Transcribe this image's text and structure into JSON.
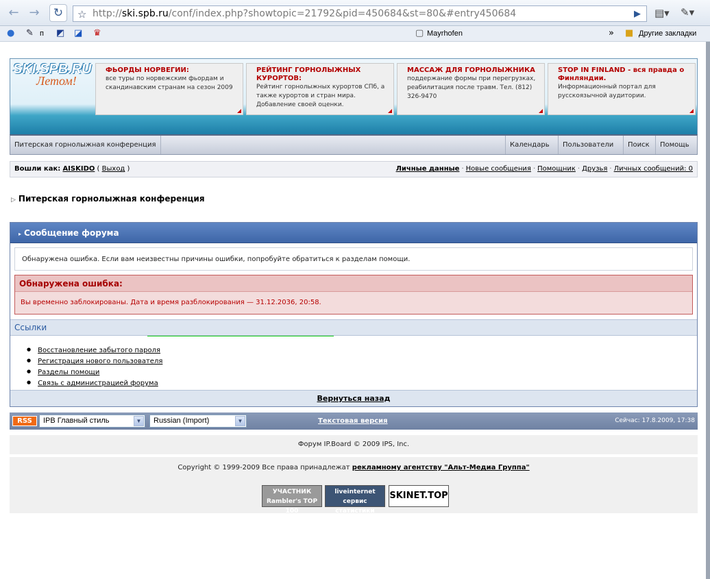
{
  "browser": {
    "url_prefix": "http://",
    "url_host": "ski.spb.ru",
    "url_rest": "/conf/index.php?showtopic=21792&pid=450684&st=80&#entry450684",
    "bookmarks": [
      "п",
      "Mayrhofen",
      "Другие закладки"
    ]
  },
  "banner": {
    "logo_top": "SKI.SPB.RU",
    "logo_bottom": "Летом!",
    "ads": [
      {
        "title": "ФЬОРДЫ НОРВЕГИИ:",
        "text": "все туры по норвежским фьордам и скандинавским странам на сезон 2009"
      },
      {
        "title": "РЕЙТИНГ ГОРНОЛЫЖНЫХ КУРОРТОВ:",
        "text": "Рейтинг горнолыжных курортов СПб, а также курортов и стран мира. Добавление своей оценки."
      },
      {
        "title": "МАССАЖ ДЛЯ ГОРНОЛЫЖНИКА",
        "text": "поддержание формы при перегрузках, реабилитация после травм. Тел. (812) 326-9470"
      },
      {
        "title": "STOP IN FINLAND - вся правда о Финляндии.",
        "text": "Информационный портал для русскоязычной аудитории."
      }
    ]
  },
  "menu": {
    "home": "Питерская горнолыжная конференция",
    "calendar": "Календарь",
    "users": "Пользователи",
    "search": "Поиск",
    "help": "Помощь"
  },
  "userbar": {
    "logged_as": "Вошли как:",
    "username": "AISKIDO",
    "logout": "Выход",
    "links": [
      "Личные данные",
      "Новые сообщения",
      "Помощник",
      "Друзья",
      "Личных сообщений: 0"
    ]
  },
  "breadcrumb": "Питерская горнолыжная конференция",
  "message": {
    "header": "Сообщение форума",
    "info": "Обнаружена ошибка. Если вам неизвестны причины ошибки, попробуйте обратиться к разделам помощи.",
    "error_title": "Обнаружена ошибка:",
    "error_text": "Вы временно заблокированы. Дата и время разблокирования — 31.12.2036, 20:58.",
    "links_title": "Ссылки",
    "links": [
      "Восстановление забытого пароля",
      "Регистрация нового пользователя",
      "Разделы помощи",
      "Связь с администрацией форума"
    ],
    "back": "Вернуться назад"
  },
  "footer": {
    "rss": "RSS",
    "style_select": "IPB Главный стиль",
    "lang_select": "Russian (Import)",
    "text_version": "Текстовая версия",
    "now": "Сейчас: 17.8.2009, 17:38",
    "powered": "Форум IP.Board © 2009  IPS, Inc.",
    "copyright_prefix": "Copyright © 1999-2009 Все права принадлежат",
    "copyright_link": "рекламному агентству \"Альт-Медиа Группа\"",
    "counters": [
      "УЧАСТНИК Rambler's TOP 100",
      "liveinternet сервис статистики",
      "SKINET.TOP"
    ]
  }
}
